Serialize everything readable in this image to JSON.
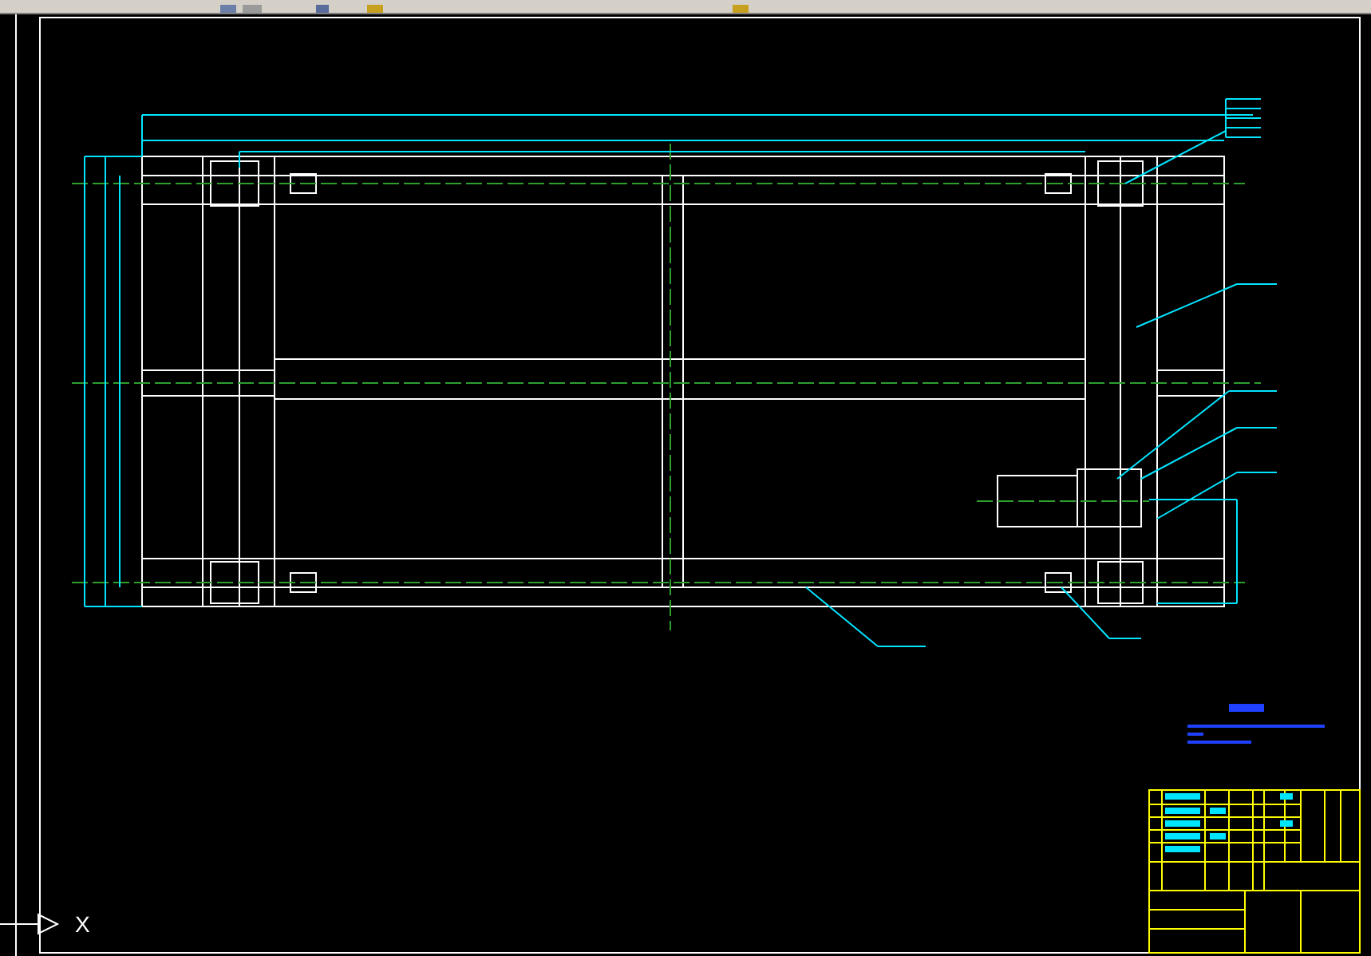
{
  "ucs_icon": {
    "axis_label": "X"
  }
}
